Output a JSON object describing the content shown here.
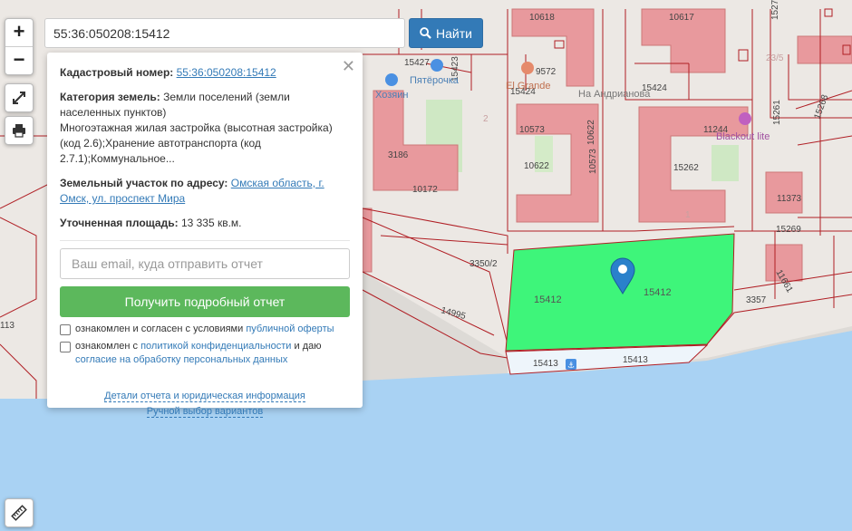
{
  "search": {
    "value": "55:36:050208:15412",
    "button_label": "Найти"
  },
  "zoom": {
    "in_label": "+",
    "out_label": "−"
  },
  "panel": {
    "cadastral_label": "Кадастровый номер:",
    "cadastral_value": "55:36:050208:15412",
    "category_label": "Категория земель:",
    "category_line1": "Земли поселений (земли",
    "category_line2": "населенных пунктов)",
    "use_line1": "Многоэтажная жилая застройка (высотная застройка)",
    "use_line2": "(код 2.6);Хранение автотранспорта (код",
    "use_line3": "2.7.1);Коммунальное...",
    "address_label": "Земельный участок по адресу:",
    "address_line1": "Омская область, г.",
    "address_line2": "Омск, ул. проспект Мира",
    "area_label": "Уточненная площадь:",
    "area_value": "13 335 кв.м.",
    "email_placeholder": "Ваш email, куда отправить отчет",
    "get_report": "Получить подробный отчет",
    "check1_text": "ознакомлен и согласен с условиями",
    "check1_link": "публичной оферты",
    "check2_text": "ознакомлен с",
    "check2_link1": "политикой конфиденциальности",
    "check2_mid": "и даю",
    "check2_link2": "согласие на обработку персональных данных",
    "link_details": "Детали отчета и юридическая информация",
    "link_manual": "Ручной выбор вариантов"
  },
  "map": {
    "parcel_labels": [
      "10618",
      "9572",
      "10617",
      "15277",
      "15427",
      "15423",
      "15424",
      "15424",
      "10573",
      "10622",
      "11244",
      "15261",
      "15268",
      "3186",
      "10622",
      "10573",
      "15262",
      "11373",
      "10172",
      "15269",
      "11661",
      "3350/2",
      "15412",
      "15412",
      "3357",
      "14995",
      "15413",
      "15413",
      "113",
      "2",
      "1",
      "23/5"
    ],
    "poi": {
      "hozyain": "Хозяин",
      "pyaterochka": "Пятёрочка",
      "el_grande": "El Grande",
      "street": "На Андрианова",
      "blackout": "Blackout lite"
    },
    "colors": {
      "selected_parcel": "#3ef57a",
      "water": "#a9d2f3",
      "building": "#e8999d",
      "boundary": "#b01e24"
    }
  }
}
